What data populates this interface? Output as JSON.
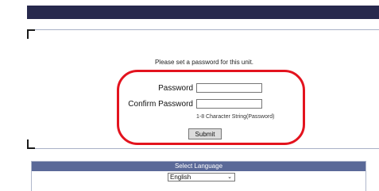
{
  "setup": {
    "instruction": "Please set a password for this unit.",
    "password_label": "Password",
    "confirm_label": "Confirm Password",
    "hint": "1-8 Character String(Password)",
    "submit_label": "Submit",
    "password_value": "",
    "confirm_value": ""
  },
  "language": {
    "header": "Select Language",
    "selected": "English"
  },
  "colors": {
    "top_bar": "#27294d",
    "highlight_ring": "#e3131e",
    "language_header": "#5a6998"
  }
}
